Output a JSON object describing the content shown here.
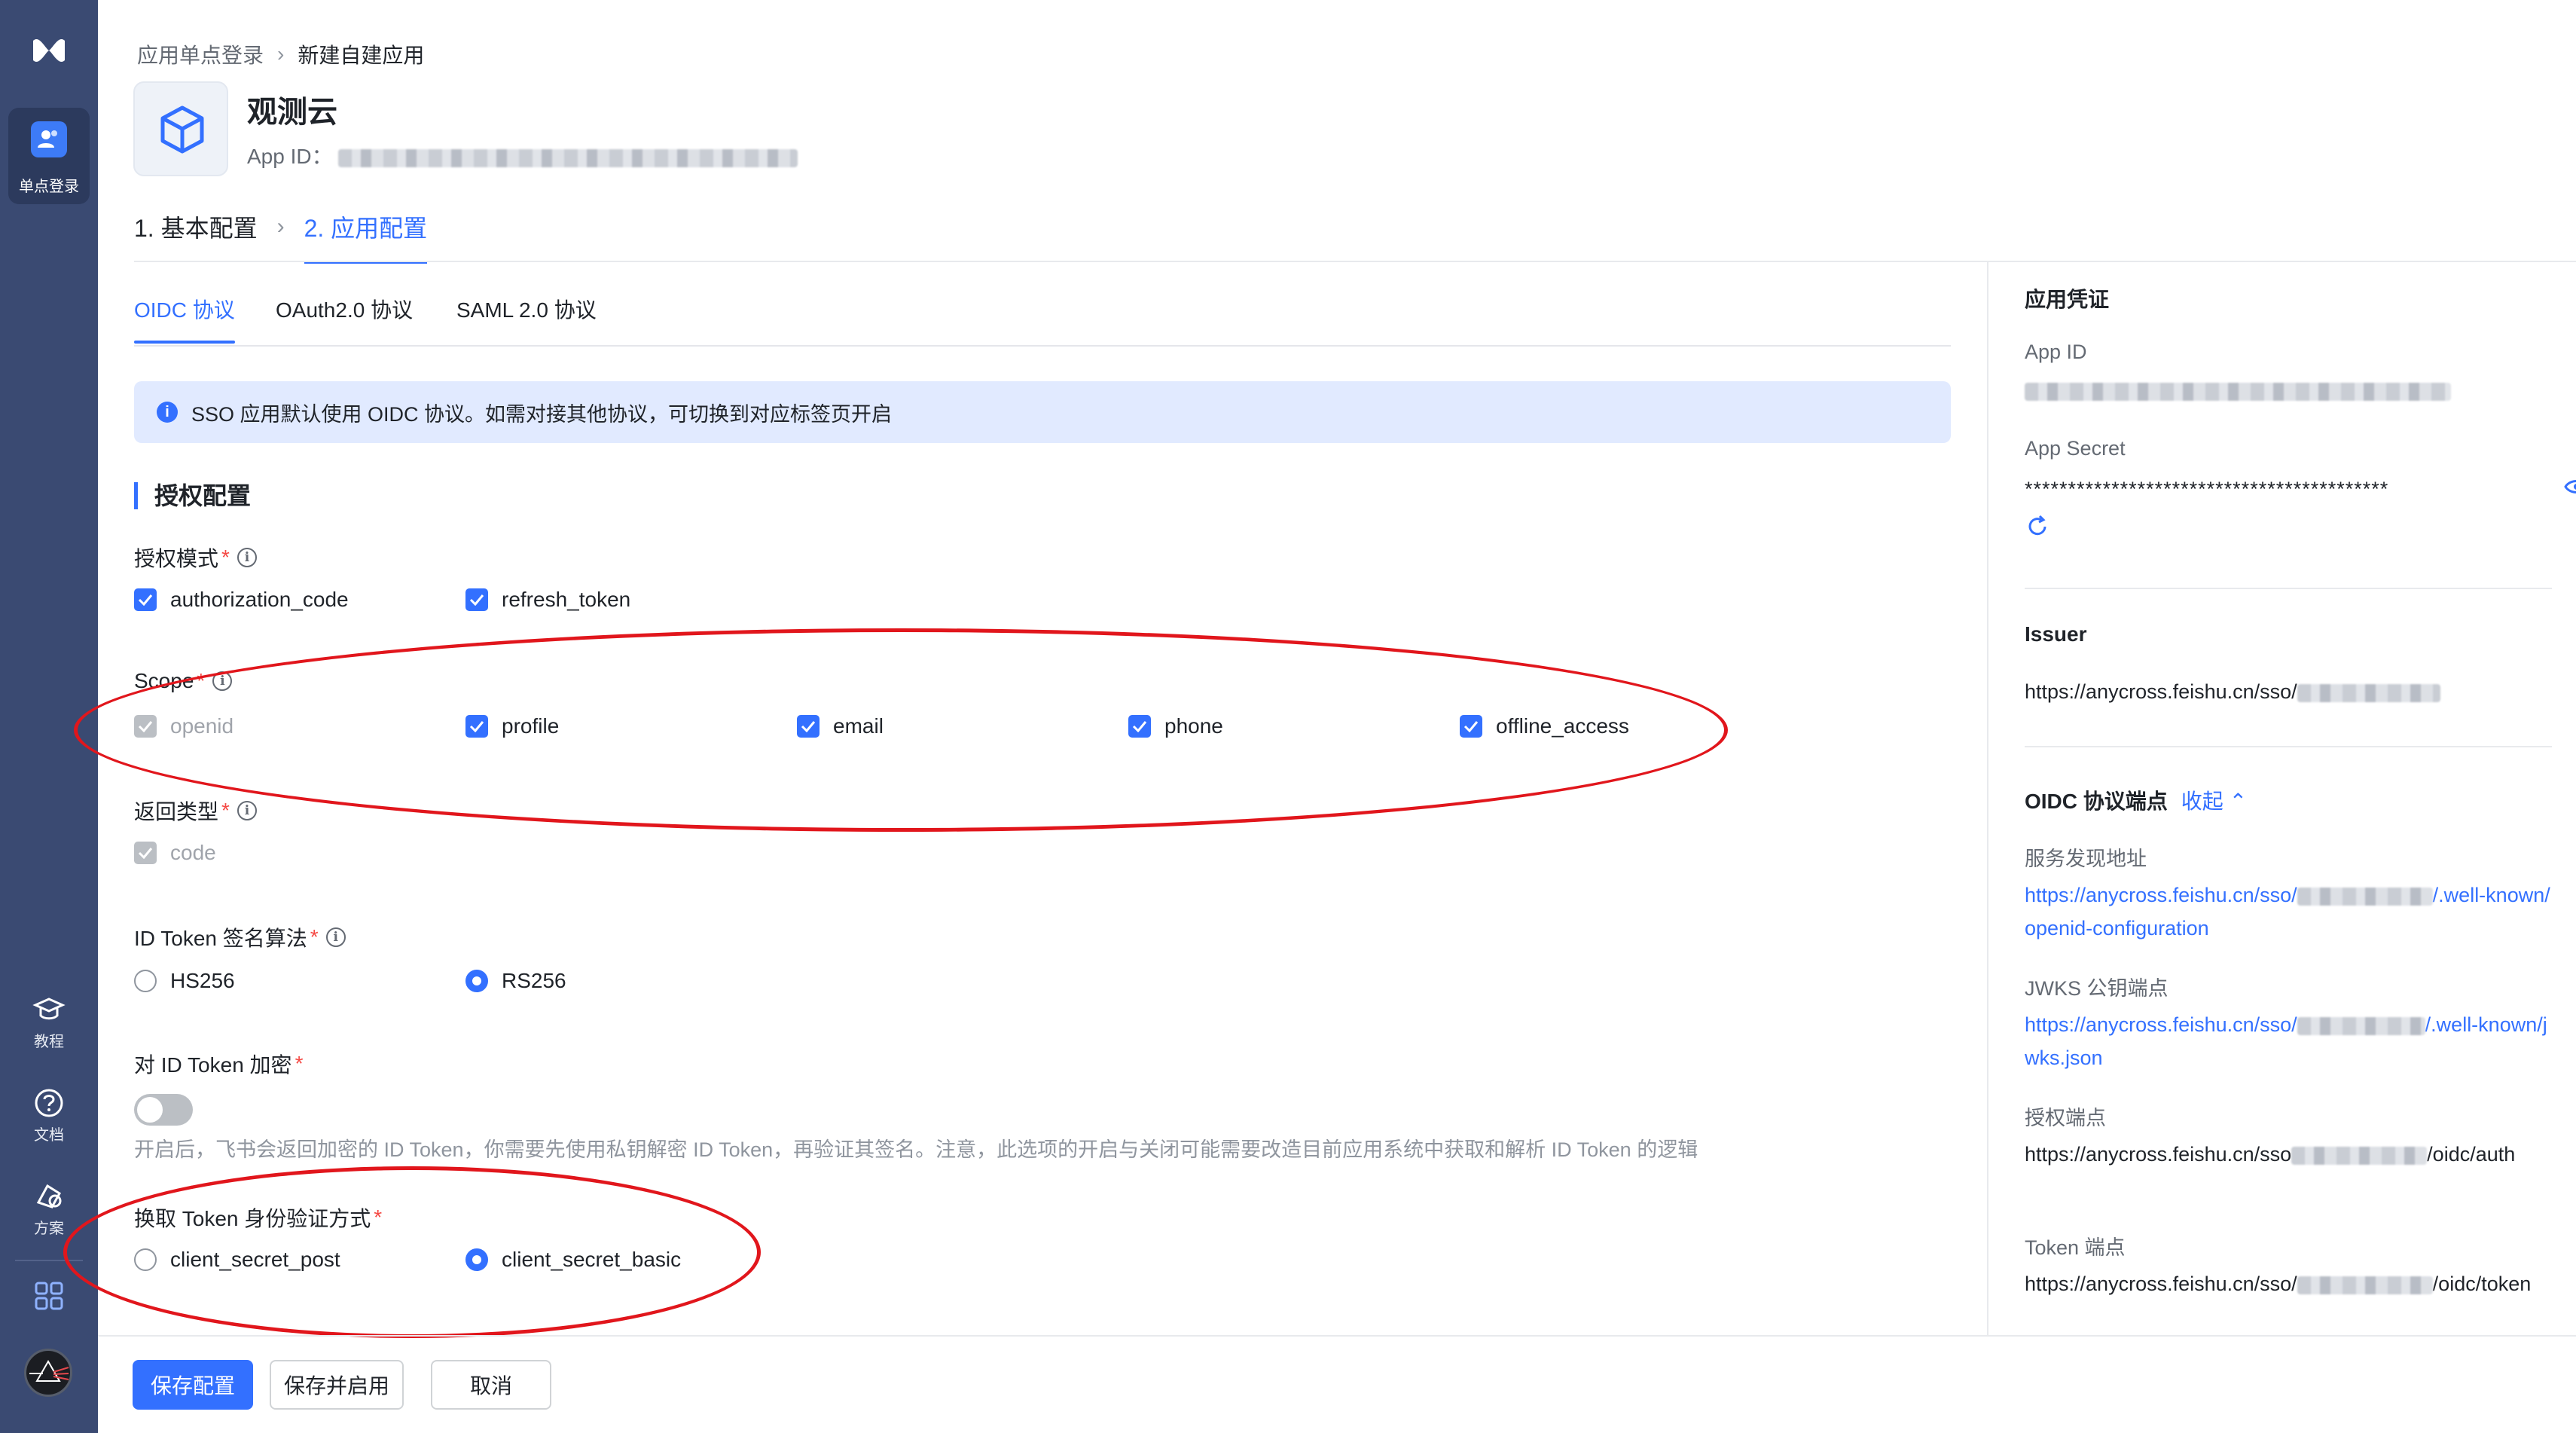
{
  "sidebar": {
    "active_label": "单点登录",
    "items": [
      {
        "label": "教程",
        "icon": "graduation-cap-icon"
      },
      {
        "label": "文档",
        "icon": "help-circle-icon"
      },
      {
        "label": "方案",
        "icon": "solution-icon"
      }
    ]
  },
  "breadcrumb": {
    "parent": "应用单点登录",
    "current": "新建自建应用"
  },
  "app": {
    "name": "观测云",
    "id_label": "App ID："
  },
  "steps": {
    "step1": "1. 基本配置",
    "step2": "2. 应用配置"
  },
  "tabs": [
    "OIDC 协议",
    "OAuth2.0 协议",
    "SAML 2.0 协议"
  ],
  "notice": "SSO 应用默认使用 OIDC 协议。如需对接其他协议，可切换到对应标签页开启",
  "auth_section": {
    "title": "授权配置",
    "grant_mode": {
      "label": "授权模式",
      "options": [
        {
          "label": "authorization_code",
          "checked": true
        },
        {
          "label": "refresh_token",
          "checked": true
        }
      ]
    },
    "scope": {
      "label": "Scope",
      "options": [
        {
          "label": "openid",
          "checked": true,
          "disabled": true
        },
        {
          "label": "profile",
          "checked": true
        },
        {
          "label": "email",
          "checked": true
        },
        {
          "label": "phone",
          "checked": true
        },
        {
          "label": "offline_access",
          "checked": true
        }
      ]
    },
    "response_type": {
      "label": "返回类型",
      "options": [
        {
          "label": "code",
          "checked": true,
          "disabled": true
        }
      ]
    },
    "id_token_alg": {
      "label": "ID Token 签名算法",
      "options": [
        {
          "label": "HS256",
          "selected": false
        },
        {
          "label": "RS256",
          "selected": true
        }
      ]
    },
    "id_token_encrypt": {
      "label": "对 ID Token 加密",
      "enabled": false,
      "hint": "开启后，飞书会返回加密的 ID Token，你需要先使用私钥解密 ID Token，再验证其签名。注意，此选项的开启与关闭可能需要改造目前应用系统中获取和解析 ID Token 的逻辑"
    },
    "token_auth": {
      "label": "换取 Token 身份验证方式",
      "options": [
        {
          "label": "client_secret_post",
          "selected": false
        },
        {
          "label": "client_secret_basic",
          "selected": true
        }
      ]
    }
  },
  "footer": {
    "save": "保存配置",
    "save_enable": "保存并启用",
    "cancel": "取消"
  },
  "credentials": {
    "title": "应用凭证",
    "app_id_label": "App ID",
    "app_secret_label": "App Secret",
    "app_secret_masked": "******************************************",
    "issuer_label": "Issuer",
    "issuer_prefix": "https://anycross.feishu.cn/sso/",
    "endpoints_title": "OIDC 协议端点",
    "collapse_label": "收起",
    "discovery_label": "服务发现地址",
    "discovery_prefix": "https://anycross.feishu.cn/sso/",
    "discovery_suffix": "/.well-known/openid-configuration",
    "jwks_label": "JWKS 公钥端点",
    "jwks_prefix": "https://anycross.feishu.cn/sso/",
    "jwks_suffix": "/.well-known/jwks.json",
    "auth_label": "授权端点",
    "auth_prefix": "https://anycross.feishu.cn/sso",
    "auth_suffix": "/oidc/auth",
    "token_label": "Token 端点",
    "token_prefix": "https://anycross.feishu.cn/sso/",
    "token_suffix": "/oidc/token"
  },
  "colors": {
    "accent": "#3370ff",
    "annotation": "#e1161c",
    "rail": "#3a4a72"
  }
}
